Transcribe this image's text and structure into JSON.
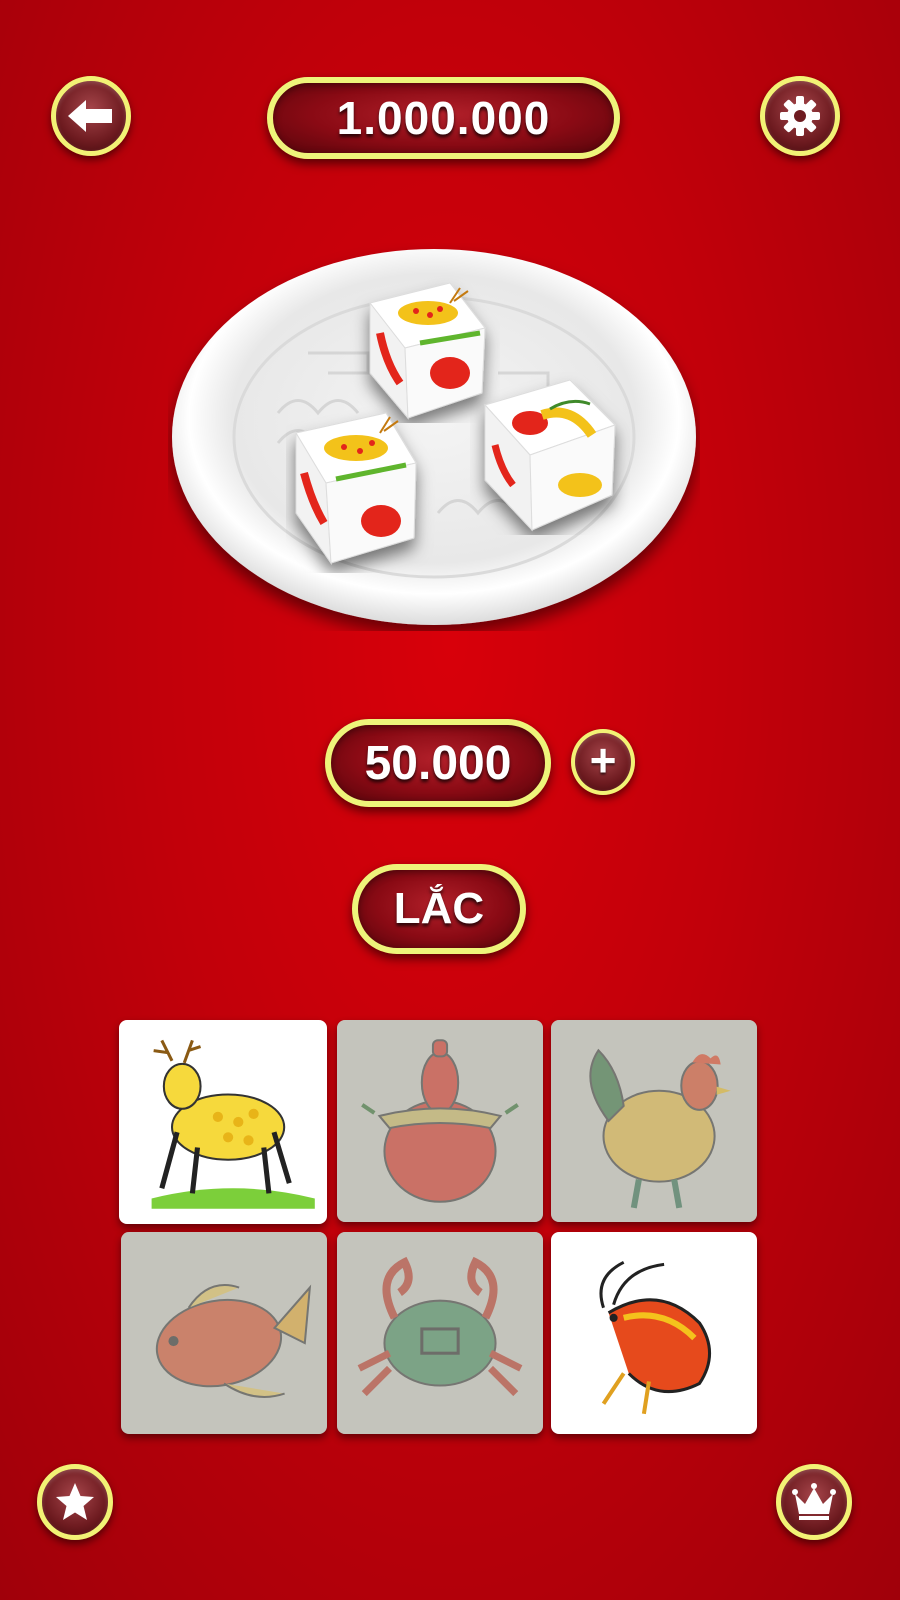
{
  "header": {
    "back_icon": "arrow-left-icon",
    "balance": "1.000.000",
    "settings_icon": "gear-icon"
  },
  "plate": {
    "dice": [
      "deer",
      "deer",
      "shrimp"
    ]
  },
  "bet": {
    "amount": "50.000",
    "plus_label": "+"
  },
  "shake_button": {
    "label": "LẮC"
  },
  "tiles": [
    {
      "name": "deer",
      "selected": true
    },
    {
      "name": "gourd",
      "selected": false
    },
    {
      "name": "rooster",
      "selected": false
    },
    {
      "name": "fish",
      "selected": false
    },
    {
      "name": "crab",
      "selected": false
    },
    {
      "name": "shrimp",
      "selected": true
    }
  ],
  "footer": {
    "left_icon": "star-icon",
    "right_icon": "crown-icon"
  },
  "colors": {
    "background": "#c2000a",
    "border_yellow": "#eef47a",
    "pill_fill": "#8a0a14"
  }
}
